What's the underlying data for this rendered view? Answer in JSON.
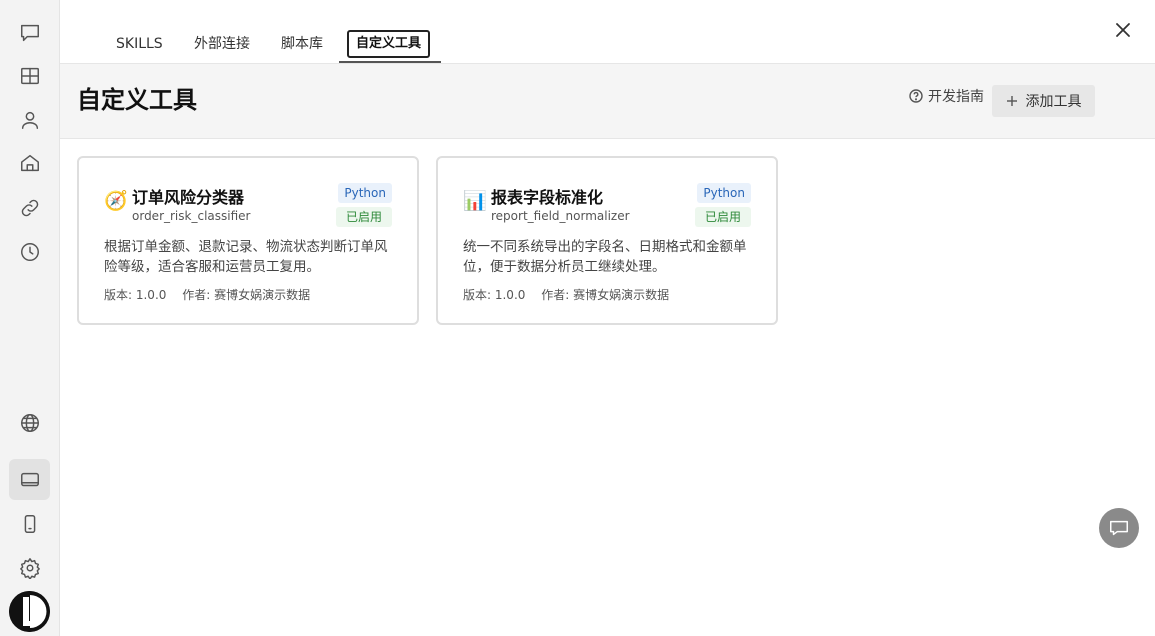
{
  "rail": {
    "items": [
      {
        "icon": "chat-bubble-icon",
        "name": "rail-chat"
      },
      {
        "icon": "grid-icon",
        "name": "rail-apps"
      },
      {
        "icon": "user-icon",
        "name": "rail-profile"
      },
      {
        "icon": "home-icon",
        "name": "rail-home"
      },
      {
        "icon": "link-icon",
        "name": "rail-links"
      },
      {
        "icon": "clock-icon",
        "name": "rail-history"
      },
      {
        "icon": "globe-icon",
        "name": "rail-language"
      },
      {
        "icon": "monitor-icon",
        "name": "rail-desktop",
        "active": true
      },
      {
        "icon": "phone-icon",
        "name": "rail-mobile"
      },
      {
        "icon": "gear-icon",
        "name": "rail-settings"
      }
    ]
  },
  "tabs": [
    {
      "label": "SKILLS"
    },
    {
      "label": "外部连接"
    },
    {
      "label": "脚本库"
    },
    {
      "label": "自定义工具",
      "active": true
    }
  ],
  "page": {
    "title": "自定义工具",
    "guide_label": "开发指南",
    "add_label": "添加工具"
  },
  "tools": [
    {
      "icon": "compass-icon",
      "icon_glyph": "🧭",
      "name": "订单风险分类器",
      "id": "order_risk_classifier",
      "language": "Python",
      "status": "已启用",
      "description": "根据订单金额、退款记录、物流状态判断订单风险等级，适合客服和运营员工复用。",
      "version": "版本: 1.0.0",
      "author": "作者: 赛博女娲演示数据"
    },
    {
      "icon": "bar-chart-icon",
      "icon_glyph": "📊",
      "name": "报表字段标准化",
      "id": "report_field_normalizer",
      "language": "Python",
      "status": "已启用",
      "description": "统一不同系统导出的字段名、日期格式和金额单位，便于数据分析员工继续处理。",
      "version": "版本: 1.0.0",
      "author": "作者: 赛博女娲演示数据"
    }
  ],
  "colors": {
    "rail_bg": "#f3f3f3",
    "header_bg": "#f5f5f5",
    "lang_badge": "#2966b8",
    "status_badge": "#2e8a3a"
  }
}
